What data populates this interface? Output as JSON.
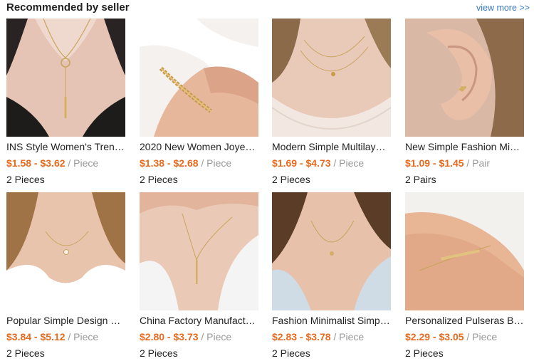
{
  "header": {
    "title": "Recommended by seller",
    "view_more": "view more >>"
  },
  "products": [
    {
      "name": "INS Style Women's Tren…",
      "price": "$1.58 - $3.62",
      "unit": "/ Piece",
      "qty": "2 Pieces",
      "image": "necklace-lariat"
    },
    {
      "name": "2020 New Women Joyer…",
      "price": "$1.38 - $2.68",
      "unit": "/ Piece",
      "qty": "2 Pieces",
      "image": "bracelet-chain"
    },
    {
      "name": "Modern Simple Multilaye…",
      "price": "$1.69 - $4.73",
      "unit": "/ Piece",
      "qty": "2 Pieces",
      "image": "necklace-layered"
    },
    {
      "name": "New Simple Fashion Mi…",
      "price": "$1.09 - $1.45",
      "unit": "/ Pair",
      "qty": "2 Pairs",
      "image": "earring-heart"
    },
    {
      "name": "Popular Simple Design …",
      "price": "$3.84 - $5.12",
      "unit": "/ Piece",
      "qty": "2 Pieces",
      "image": "necklace-pearl"
    },
    {
      "name": "China Factory Manufact…",
      "price": "$2.80 - $3.73",
      "unit": "/ Piece",
      "qty": "2 Pieces",
      "image": "necklace-bar"
    },
    {
      "name": "Fashion Minimalist Simp…",
      "price": "$2.83 - $3.78",
      "unit": "/ Piece",
      "qty": "2 Pieces",
      "image": "necklace-pendant"
    },
    {
      "name": "Personalized Pulseras B…",
      "price": "$2.29 - $3.05",
      "unit": "/ Piece",
      "qty": "2 Pieces",
      "image": "bracelet-bar"
    }
  ],
  "colors": {
    "price": "#e86a1f",
    "link": "#3b7bbf",
    "muted": "#999999"
  }
}
